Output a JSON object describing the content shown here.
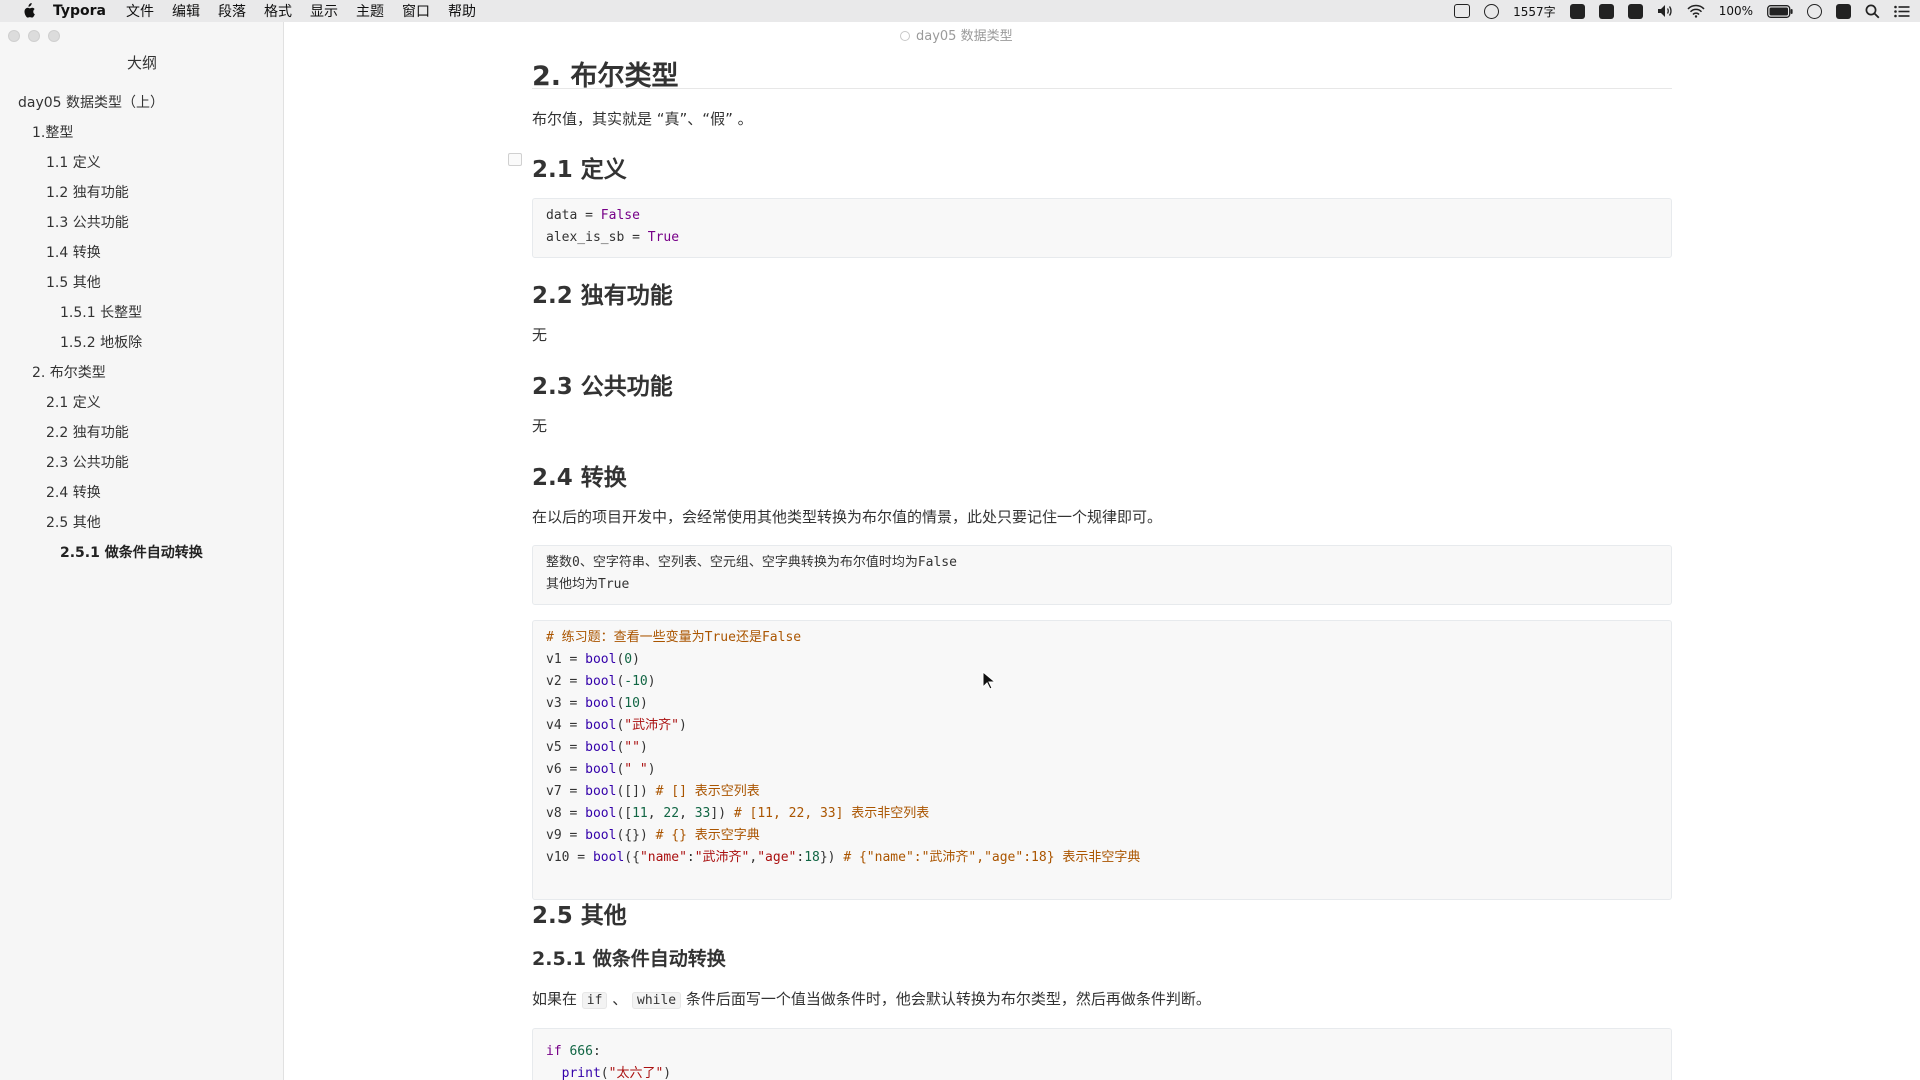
{
  "menubar": {
    "app_name": "Typora",
    "menus": [
      "文件",
      "编辑",
      "段落",
      "格式",
      "显示",
      "主题",
      "窗口",
      "帮助"
    ],
    "word_count": "1557字",
    "battery": "100%"
  },
  "window": {
    "doc_title": "day05 数据类型"
  },
  "sidebar": {
    "title": "大纲",
    "items": [
      {
        "label": "day05 数据类型（上）"
      },
      {
        "label": "1.整型"
      },
      {
        "label": "1.1 定义"
      },
      {
        "label": "1.2 独有功能"
      },
      {
        "label": "1.3 公共功能"
      },
      {
        "label": "1.4 转换"
      },
      {
        "label": "1.5 其他"
      },
      {
        "label": "1.5.1 长整型"
      },
      {
        "label": "1.5.2 地板除"
      },
      {
        "label": "2. 布尔类型"
      },
      {
        "label": "2.1 定义"
      },
      {
        "label": "2.2 独有功能"
      },
      {
        "label": "2.3 公共功能"
      },
      {
        "label": "2.4 转换"
      },
      {
        "label": "2.5 其他"
      },
      {
        "label": "2.5.1 做条件自动转换"
      }
    ]
  },
  "content": {
    "h1": "2. 布尔类型",
    "intro": "布尔值，其实就是 “真”、“假” 。",
    "sec_2_1": "2.1 定义",
    "code_2_1": {
      "l1": [
        "data",
        " = ",
        "False"
      ],
      "l2": [
        "alex_is_sb",
        " = ",
        "True"
      ]
    },
    "sec_2_2": "2.2 独有功能",
    "text_2_2": "无",
    "sec_2_3": "2.3 公共功能",
    "text_2_3": "无",
    "sec_2_4": "2.4 转换",
    "text_2_4": "在以后的项目开发中，会经常使用其他类型转换为布尔值的情景，此处只要记住一个规律即可。",
    "rule_block": {
      "l1": "整数0、空字符串、空列表、空元组、空字典转换为布尔值时均为False",
      "l2": "其他均为True"
    },
    "exercise_block": {
      "comment": "# 练习题：查看一些变量为True还是False",
      "lines": [
        {
          "var": "v1",
          "arg": "0",
          "kind": "num"
        },
        {
          "var": "v2",
          "arg": "-10",
          "kind": "num"
        },
        {
          "var": "v3",
          "arg": "10",
          "kind": "num"
        },
        {
          "var": "v4",
          "arg": "\"武沛齐\"",
          "kind": "str"
        },
        {
          "var": "v5",
          "arg": "\"\"",
          "kind": "str"
        },
        {
          "var": "v6",
          "arg": "\" \"",
          "kind": "str"
        },
        {
          "var": "v7",
          "arg": "[]",
          "kind": "plain",
          "comment": "# [] 表示空列表"
        },
        {
          "var": "v8",
          "arg": "[11, 22, 33]",
          "kind": "list",
          "comment": "# [11, 22, 33] 表示非空列表"
        },
        {
          "var": "v9",
          "arg": "{}",
          "kind": "plain",
          "comment": "# {} 表示空字典"
        },
        {
          "var": "v10",
          "arg": "{\"name\":\"武沛齐\",\"age\":18}",
          "kind": "dict",
          "comment": "# {\"name\":\"武沛齐\",\"age\":18} 表示非空字典"
        }
      ],
      "func": "bool"
    },
    "sec_2_5": "2.5 其他",
    "sec_2_5_1": "2.5.1 做条件自动转换",
    "text_2_5_1": {
      "before": "如果在 ",
      "code1": "if",
      "sep": " 、",
      "code2": "while",
      "after": " 条件后面写一个值当做条件时，他会默认转换为布尔类型，然后再做条件判断。"
    },
    "if_block": {
      "kw": "if",
      "num": "666",
      "colon": ":",
      "print_fn": "print",
      "print_arg": "\"太六了\""
    }
  }
}
